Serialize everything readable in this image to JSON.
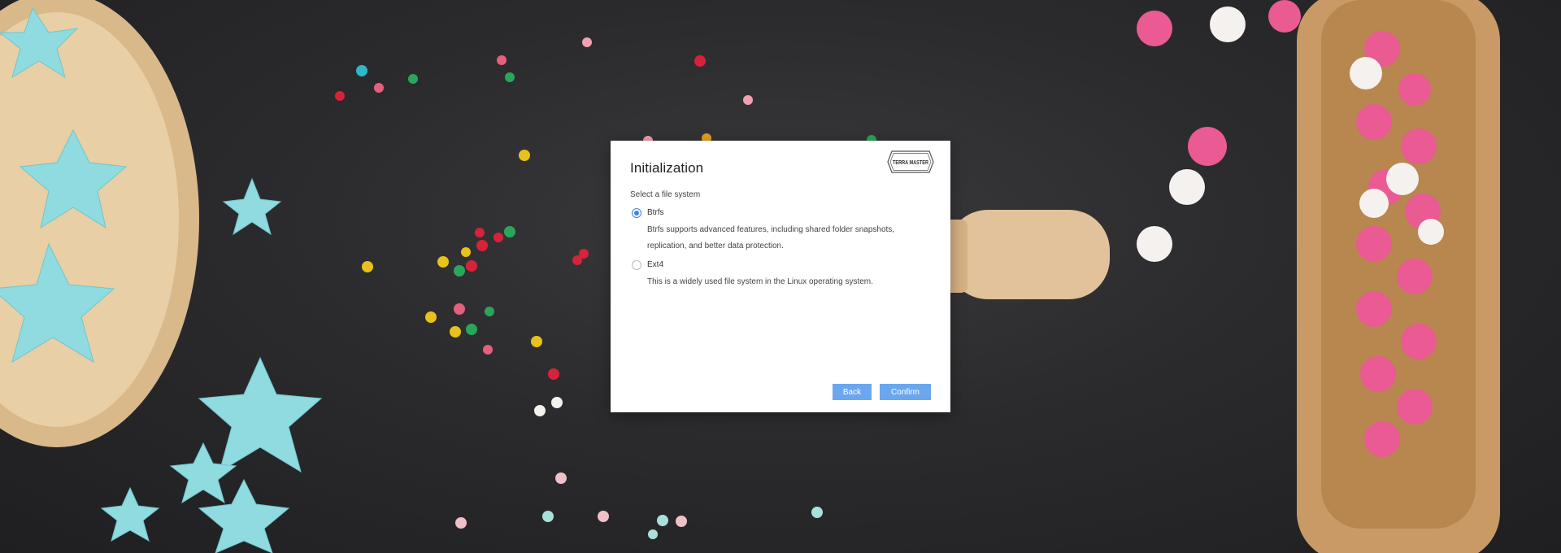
{
  "modal": {
    "title": "Initialization",
    "brand": "TERRA MASTER",
    "section_label": "Select a file system",
    "options": [
      {
        "name": "Btrfs",
        "checked": true,
        "description": "Btrfs supports advanced features, including shared folder snapshots, replication, and better data protection."
      },
      {
        "name": "Ext4",
        "checked": false,
        "description": "This is a widely used file system in the Linux operating system."
      }
    ],
    "buttons": {
      "back": "Back",
      "confirm": "Confirm"
    }
  },
  "colors": {
    "accent": "#3e82e8",
    "button": "#6aa7ef",
    "background": "#2b2b2e"
  }
}
